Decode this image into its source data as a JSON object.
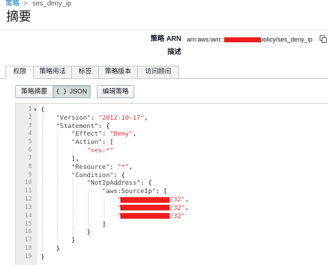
{
  "breadcrumb": {
    "parent": "策略",
    "separator": ">",
    "current": "ses_deny_ip"
  },
  "page_title": "摘要",
  "summary": {
    "arn_label": "策略 ARN",
    "arn_prefix": "arn:aws:iam::",
    "arn_suffix": "policy/ses_deny_ip",
    "copy_icon": "copy-icon",
    "description_label": "描述"
  },
  "tabs": [
    {
      "label": "权限",
      "active": true
    },
    {
      "label": "策略用法",
      "active": false
    },
    {
      "label": "标签",
      "active": false
    },
    {
      "label": "策略版本",
      "active": false
    },
    {
      "label": "访问顾问",
      "active": false
    }
  ],
  "view_toggle": {
    "summary_label": "策略摘要",
    "json_icon": "{ }",
    "json_label": "JSON",
    "json_selected": true
  },
  "edit_button": "编辑策略",
  "colors": {
    "link": "#0073bb",
    "json_string": "#d2373c",
    "redaction": "#ee1c1c"
  },
  "editor": {
    "lines": [
      {
        "n": 1,
        "fold": true,
        "indent": "",
        "tokens": [
          [
            "p",
            "{"
          ]
        ]
      },
      {
        "n": 2,
        "indent": "    ",
        "tokens": [
          [
            "key",
            "\"Version\""
          ],
          [
            "p",
            ": "
          ],
          [
            "str",
            "\"2012-10-17\""
          ],
          [
            "p",
            ","
          ]
        ]
      },
      {
        "n": 3,
        "indent": "    ",
        "tokens": [
          [
            "key",
            "\"Statement\""
          ],
          [
            "p",
            ": {"
          ]
        ]
      },
      {
        "n": 4,
        "indent": "        ",
        "tokens": [
          [
            "key",
            "\"Effect\""
          ],
          [
            "p",
            ": "
          ],
          [
            "str",
            "\"Deny\""
          ],
          [
            "p",
            ","
          ]
        ]
      },
      {
        "n": 5,
        "indent": "        ",
        "tokens": [
          [
            "key",
            "\"Action\""
          ],
          [
            "p",
            ": ["
          ]
        ]
      },
      {
        "n": 6,
        "indent": "            ",
        "tokens": [
          [
            "str",
            "\"ses:*\""
          ]
        ]
      },
      {
        "n": 7,
        "indent": "        ",
        "tokens": [
          [
            "p",
            "],"
          ]
        ]
      },
      {
        "n": 8,
        "indent": "        ",
        "tokens": [
          [
            "key",
            "\"Resource\""
          ],
          [
            "p",
            ": "
          ],
          [
            "str",
            "\"*\""
          ],
          [
            "p",
            ","
          ]
        ]
      },
      {
        "n": 9,
        "indent": "        ",
        "tokens": [
          [
            "key",
            "\"Condition\""
          ],
          [
            "p",
            ": {"
          ]
        ]
      },
      {
        "n": 10,
        "indent": "            ",
        "tokens": [
          [
            "key",
            "\"NotIpAddress\""
          ],
          [
            "p",
            ": {"
          ]
        ]
      },
      {
        "n": 11,
        "indent": "                ",
        "tokens": [
          [
            "key",
            "\"aws:SourceIp\""
          ],
          [
            "p",
            ": ["
          ]
        ]
      },
      {
        "n": 12,
        "indent": "                    ",
        "tokens": [
          [
            "str",
            "\""
          ],
          [
            "redacted"
          ],
          [
            "str",
            "/32\""
          ],
          [
            "p",
            ","
          ]
        ]
      },
      {
        "n": 13,
        "indent": "                    ",
        "tokens": [
          [
            "str",
            "\""
          ],
          [
            "redacted"
          ],
          [
            "str",
            "/32\""
          ],
          [
            "p",
            ","
          ]
        ]
      },
      {
        "n": 14,
        "indent": "                    ",
        "tokens": [
          [
            "str",
            "\""
          ],
          [
            "redacted"
          ],
          [
            "str",
            "/32\""
          ]
        ]
      },
      {
        "n": 15,
        "indent": "                ",
        "tokens": [
          [
            "p",
            "]"
          ]
        ]
      },
      {
        "n": 16,
        "indent": "            ",
        "tokens": [
          [
            "p",
            "}"
          ]
        ]
      },
      {
        "n": 17,
        "indent": "        ",
        "tokens": [
          [
            "p",
            "}"
          ]
        ]
      },
      {
        "n": 18,
        "indent": "    ",
        "tokens": [
          [
            "p",
            "}"
          ]
        ]
      },
      {
        "n": 19,
        "indent": "",
        "tokens": [
          [
            "p",
            "}"
          ]
        ]
      }
    ]
  }
}
